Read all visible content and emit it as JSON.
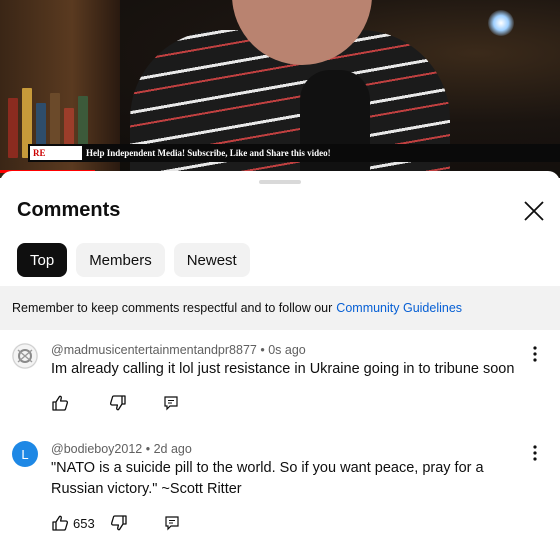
{
  "video": {
    "banner_logo": "RE",
    "banner_text": "Help Independent Media! Subscribe, Like and Share this video!",
    "progress_fraction": 0.17
  },
  "comments_panel": {
    "title": "Comments",
    "close_icon": "close-icon",
    "tabs": [
      {
        "label": "Top",
        "active": true
      },
      {
        "label": "Members",
        "active": false
      },
      {
        "label": "Newest",
        "active": false
      }
    ],
    "notice_text": "Remember to keep comments respectful and to follow our",
    "notice_link": "Community Guidelines"
  },
  "comments": [
    {
      "author": "@madmusicentertainmentandpr8877",
      "time": "0s ago",
      "text": "Im already calling it lol just resistance in Ukraine going in to tribune soon",
      "likes": "",
      "avatar_color": "#e8e8e8"
    },
    {
      "author": "@bodieboy2012",
      "time": "2d ago",
      "text": "\"NATO is a suicide pill to the world. So if you want peace, pray for a Russian victory.\" ~Scott Ritter",
      "likes": "653",
      "avatar_letter": "L",
      "avatar_color": "#1e88e5"
    }
  ],
  "colors": {
    "accent_link": "#065fd4",
    "active_chip": "#0f0f0f",
    "progress": "#ff0000"
  }
}
